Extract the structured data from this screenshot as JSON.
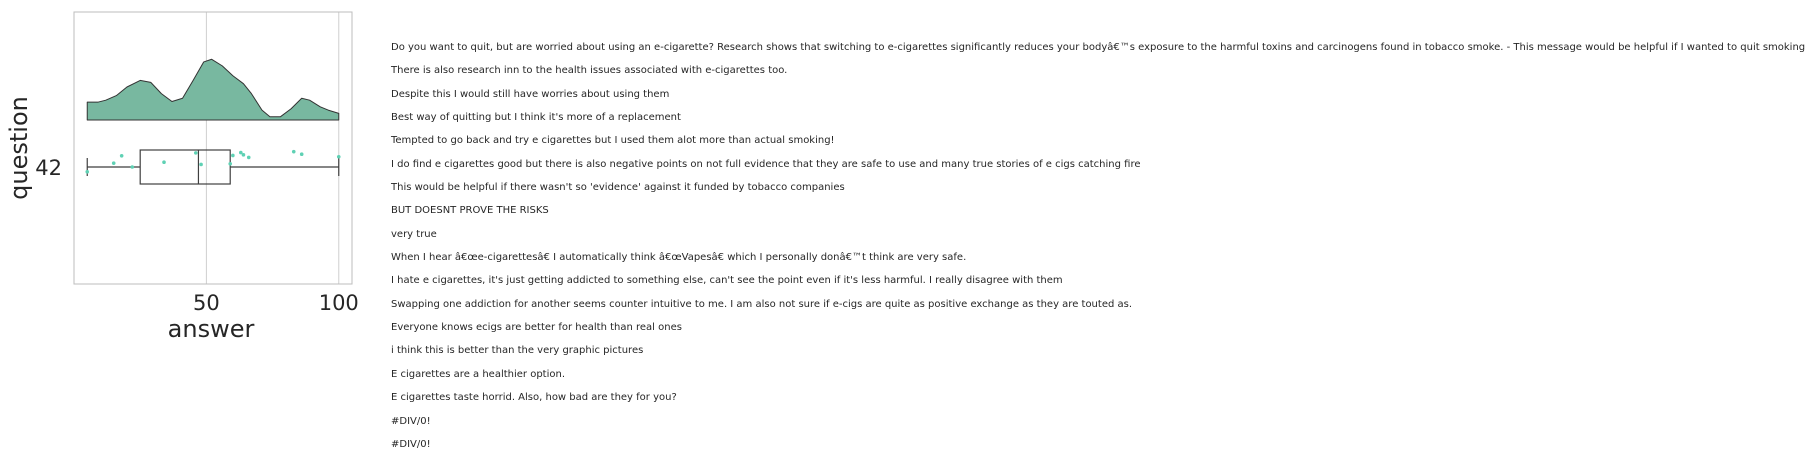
{
  "chart_data": {
    "type": "raincloud",
    "xlabel": "answer",
    "ylabel": "question",
    "category": "42",
    "xticks": [
      50,
      100
    ],
    "xlim": [
      0,
      105
    ],
    "grid": true,
    "colors": {
      "density_fill": "#78b8a0",
      "density_edge": "#333333",
      "points": "#5fd1b4",
      "box_edge": "#3f3f3f",
      "grid": "#cfcfcf",
      "frame": "#bdbdbd"
    },
    "box": {
      "min": 5,
      "q1": 25,
      "median": 47,
      "q3": 59,
      "max": 100
    },
    "density": [
      [
        5,
        0.27
      ],
      [
        9,
        0.27
      ],
      [
        12,
        0.3
      ],
      [
        16,
        0.37
      ],
      [
        20,
        0.5
      ],
      [
        25,
        0.6
      ],
      [
        29,
        0.57
      ],
      [
        33,
        0.4
      ],
      [
        37,
        0.28
      ],
      [
        41,
        0.33
      ],
      [
        45,
        0.6
      ],
      [
        49,
        0.88
      ],
      [
        52,
        0.92
      ],
      [
        56,
        0.82
      ],
      [
        60,
        0.67
      ],
      [
        64,
        0.55
      ],
      [
        67,
        0.4
      ],
      [
        71,
        0.15
      ],
      [
        74,
        0.05
      ],
      [
        78,
        0.05
      ],
      [
        82,
        0.17
      ],
      [
        86,
        0.33
      ],
      [
        89,
        0.3
      ],
      [
        93,
        0.2
      ],
      [
        96,
        0.15
      ],
      [
        100,
        0.1
      ]
    ],
    "points": [
      [
        5,
        -0.15
      ],
      [
        15,
        0.12
      ],
      [
        18,
        0.35
      ],
      [
        22,
        0.0
      ],
      [
        34,
        0.15
      ],
      [
        46,
        0.44
      ],
      [
        48,
        0.08
      ],
      [
        59,
        0.1
      ],
      [
        60,
        0.36
      ],
      [
        63,
        0.45
      ],
      [
        64,
        0.38
      ],
      [
        66,
        0.3
      ],
      [
        83,
        0.48
      ],
      [
        86,
        0.4
      ],
      [
        100,
        0.32
      ]
    ]
  },
  "comments": [
    "Do you want to quit, but are worried about using an e-cigarette? Research shows that switching to e-cigarettes significantly reduces your bodyâ€™s exposure to the harmful toxins and carcinogens found in tobacco smoke. - This message would be helpful if I wanted to quit smoking",
    "There is also research inn to the health issues associated with e-cigarettes too.",
    "Despite this I would still have worries about using them",
    "Best way of quitting but I think it's more of a replacement",
    "Tempted to go back and try e cigarettes but I used them alot more than actual smoking!",
    "I do find e cigarettes good but there is also negative points on not full evidence that they are safe to use and many true stories of e cigs catching fire",
    "This would be helpful if there wasn't so 'evidence' against it funded by tobacco companies",
    "BUT DOESNT PROVE THE RISKS",
    "very true",
    "When I hear â€œe-cigarettesâ€ I automatically think â€œVapesâ€ which I personally donâ€™t think are very safe.",
    "I hate e cigarettes, it's just getting addicted to something else, can't see the point even if it's less harmful. I really disagree with them",
    "Swapping one addiction for another seems counter intuitive to me.  I am also not sure if e-cigs are quite as positive exchange as they are touted as.",
    "Everyone knows ecigs are better for health than real ones",
    "i think this is better than the very graphic pictures",
    "E cigarettes are a healthier option.",
    "E cigarettes taste horrid. Also, how bad are they for you?",
    "#DIV/0!",
    "#DIV/0!"
  ]
}
